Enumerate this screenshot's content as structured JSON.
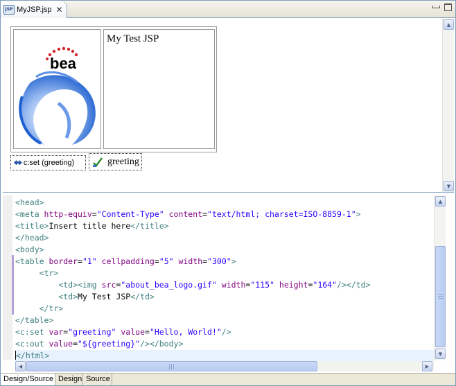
{
  "editor_tab": {
    "icon_text": "JSP",
    "title": "MyJSP.jsp",
    "close_glyph": "✕"
  },
  "window_controls": {
    "minimize": "minimize",
    "maximize": "maximize"
  },
  "design_view": {
    "logo_wordmark": "bea",
    "cell_text": "My Test JSP",
    "cset_widget": "c:set (greeting)",
    "cout_widget": "greeting"
  },
  "source_view": {
    "lines": [
      [
        "t:<head>"
      ],
      [
        "t:<meta ",
        "a:http-equiv",
        "x:=",
        "v:\"Content-Type\"",
        "x: ",
        "a:content",
        "x:=",
        "v:\"text/html; charset=ISO-8859-1\"",
        "t:>"
      ],
      [
        "t:<title>",
        "x:Insert title here",
        "t:</title>"
      ],
      [
        "t:</head>"
      ],
      [
        "t:<body>"
      ],
      [
        "t:<table ",
        "a:border",
        "x:=",
        "v:\"1\"",
        "x: ",
        "a:cellpadding",
        "x:=",
        "v:\"5\"",
        "x: ",
        "a:width",
        "x:=",
        "v:\"300\"",
        "t:>"
      ],
      [
        "x:     ",
        "t:<tr>"
      ],
      [
        "x:         ",
        "t:<td>",
        "t:<img ",
        "a:src",
        "x:=",
        "v:\"about_bea_logo.gif\"",
        "x: ",
        "a:width",
        "x:=",
        "v:\"115\"",
        "x: ",
        "a:height",
        "x:=",
        "v:\"164\"",
        "t:/>",
        "t:</td>"
      ],
      [
        "x:         ",
        "t:<td>",
        "x:My Test JSP",
        "t:</td>"
      ],
      [
        "x:     ",
        "t:</tr>"
      ],
      [
        "t:</table>"
      ],
      [
        "t:<c:set ",
        "a:var",
        "x:=",
        "v:\"greeting\"",
        "x: ",
        "a:value",
        "x:=",
        "v:\"Hello, World!\"",
        "t:/>"
      ],
      [
        "t:<c:out ",
        "a:value",
        "x:=",
        "v:\"${greeting}\"",
        "t:/>",
        "t:</body>"
      ],
      [
        "t:</html>"
      ]
    ],
    "current_line_index": 13
  },
  "bottom_tabs": [
    "Design/Source",
    "Design",
    "Source"
  ],
  "active_bottom_tab": 0,
  "icons": {
    "jsp_file": "jsp-file-icon",
    "close": "close-icon",
    "cset": "cset-icon",
    "cout": "cout-check-icon",
    "scroll_up": "arrow-up-icon",
    "scroll_down": "arrow-down-icon",
    "scroll_left": "arrow-left-icon",
    "scroll_right": "arrow-right-icon"
  },
  "colors": {
    "tag": "#3f7f7f",
    "attribute": "#7f007f",
    "value": "#2a00ff",
    "current_line": "#e8f2fe",
    "logo_red": "#d4232b",
    "logo_blue": "#1d5fd0"
  }
}
